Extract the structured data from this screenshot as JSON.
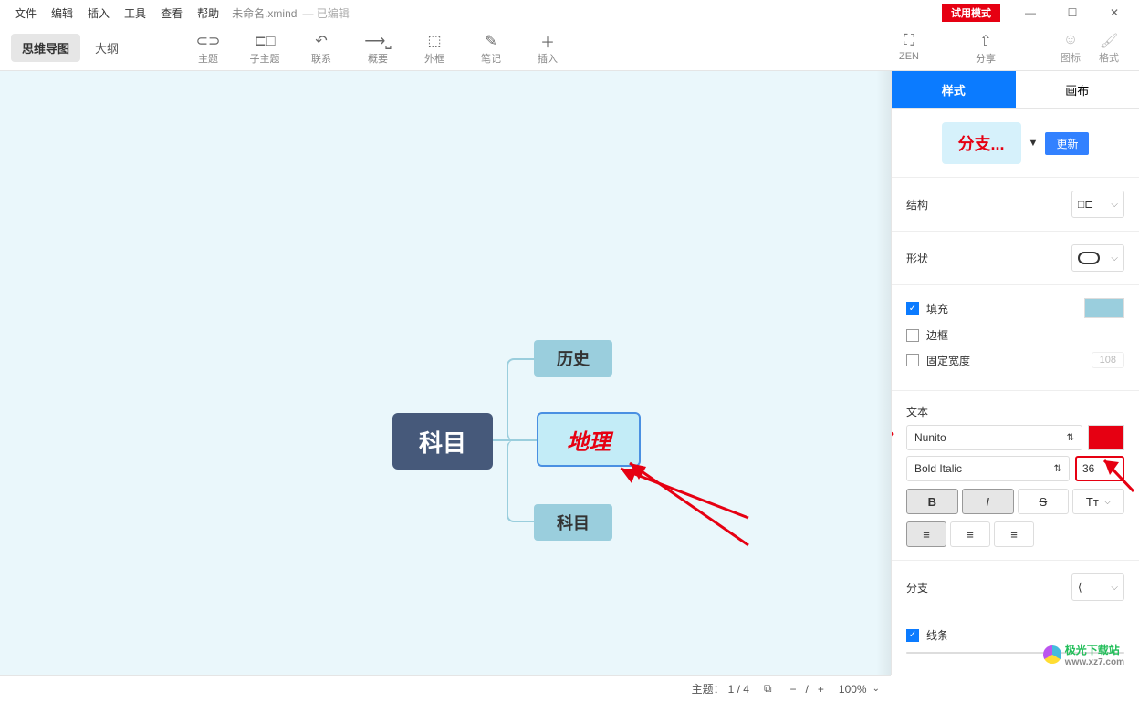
{
  "menubar": {
    "file": "文件",
    "edit": "编辑",
    "insert": "插入",
    "tools": "工具",
    "view": "查看",
    "help": "帮助"
  },
  "title": {
    "filename": "未命名.xmind",
    "modified": "— 已编辑",
    "trial": "试用模式"
  },
  "win": {
    "min": "—",
    "max": "☐",
    "close": "✕"
  },
  "toolbar": {
    "tab_mindmap": "思维导图",
    "tab_outline": "大纲",
    "topic": "主题",
    "subtopic": "子主题",
    "relation": "联系",
    "summary": "概要",
    "boundary": "外框",
    "note": "笔记",
    "insert": "插入",
    "zen": "ZEN",
    "share": "分享",
    "icons": "图标",
    "format": "格式"
  },
  "mindmap": {
    "root": "科目",
    "child1": "历史",
    "child2": "地理",
    "child3": "科目"
  },
  "panel": {
    "tab_style": "样式",
    "tab_canvas": "画布",
    "theme_chip": "分支...",
    "update": "更新",
    "structure": "结构",
    "shape": "形状",
    "fill": "填充",
    "border": "边框",
    "fixed_width": "固定宽度",
    "fixed_width_val": "108",
    "text": "文本",
    "font_family": "Nunito",
    "font_weight": "Bold Italic",
    "font_size": "36",
    "branch": "分支",
    "line": "线条"
  },
  "status": {
    "topics_label": "主题：",
    "topics": "1 / 4",
    "minus": "−",
    "plus": "+",
    "zoom": "100%"
  },
  "watermark": {
    "t1": "极光下载站",
    "t2": "www.xz7.com"
  }
}
